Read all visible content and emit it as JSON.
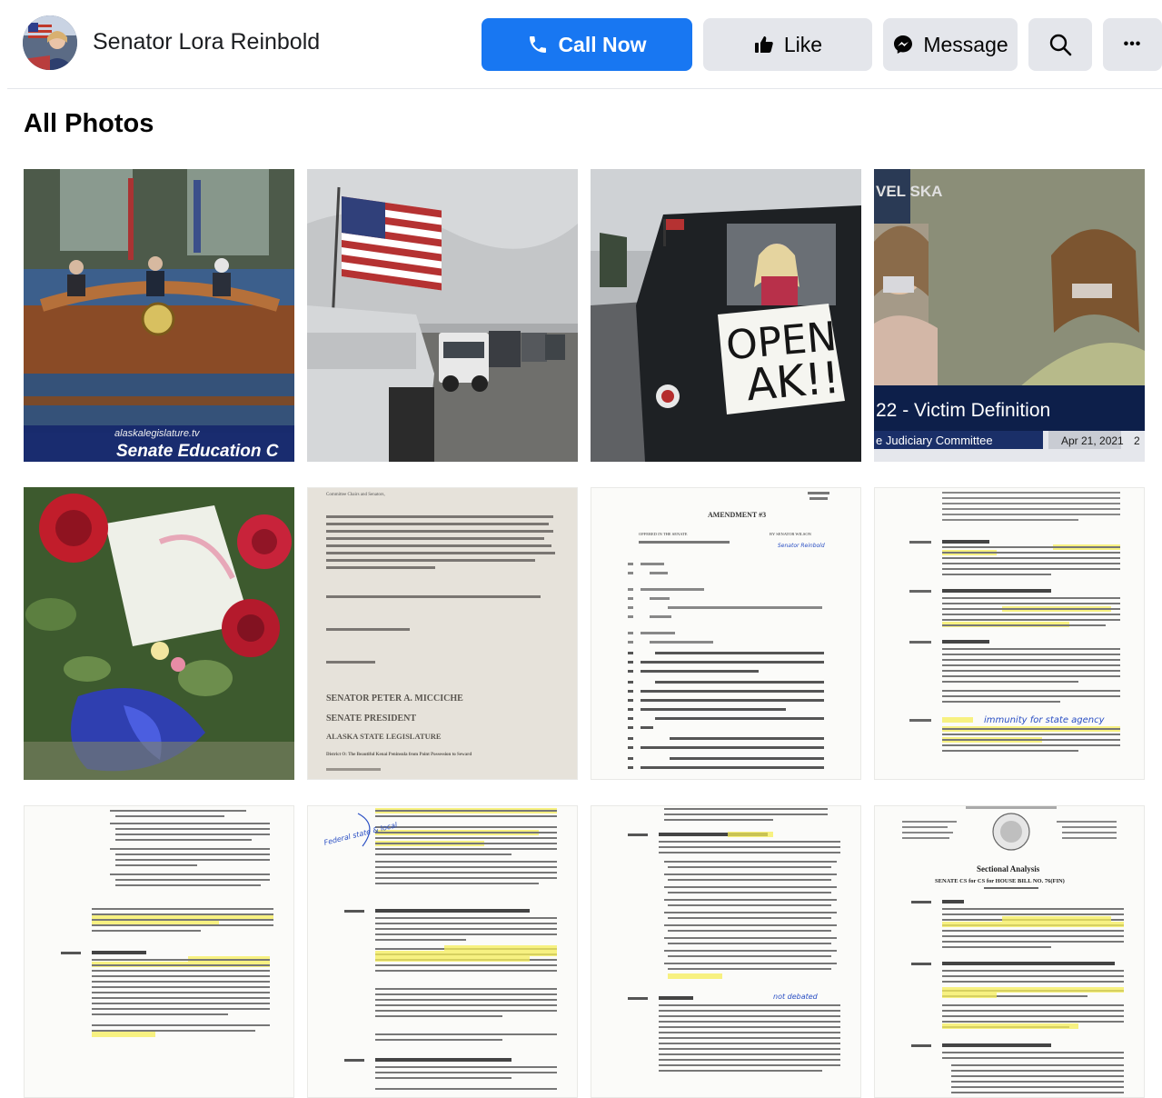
{
  "header": {
    "page_name": "Senator Lora Reinbold",
    "call_label": "Call Now",
    "like_label": "Like",
    "message_label": "Message",
    "more_label": "•••"
  },
  "icons": [
    "phone-icon",
    "thumbs-up-icon",
    "messenger-icon",
    "search-icon",
    "more-icon"
  ],
  "colors": {
    "primary": "#1877f2",
    "secondary_button": "#e4e6eb",
    "text": "#050505"
  },
  "section": {
    "title": "All Photos"
  },
  "photos": {
    "p1": {
      "logo_text": "alaskalegislature.tv",
      "caption": "Senate Education C"
    },
    "p3": {
      "sign_line1": "OPEN",
      "sign_line2": "AK!!"
    },
    "p4": {
      "brand": "VEL\nSKA",
      "banner": "22 - Victim Definition",
      "committee": "e Judiciary Committee",
      "date": "Apr 21, 2021",
      "extra": "2"
    },
    "p6": {
      "salutation": "Committee Chairs and Senators,",
      "name": "SENATOR PETER A. MICCICHE",
      "title": "SENATE PRESIDENT",
      "org": "ALASKA STATE LEGISLATURE",
      "district": "District O: The Beautiful Kenai Peninsula from Point Possession to Seward"
    },
    "p7": {
      "heading": "AMENDMENT #3",
      "offered": "OFFERED IN THE SENATE",
      "by": "BY SENATOR WILSON",
      "handwriting": "Senator Reinbold"
    },
    "p8": {
      "note": "immunity for state agency"
    },
    "p10": {
      "note": "Federal state & local"
    },
    "p11": {
      "note": "not debated"
    },
    "p12": {
      "title": "Sectional Analysis",
      "subtitle": "SENATE CS for CS for HOUSE BILL NO. 76(FIN)"
    }
  }
}
